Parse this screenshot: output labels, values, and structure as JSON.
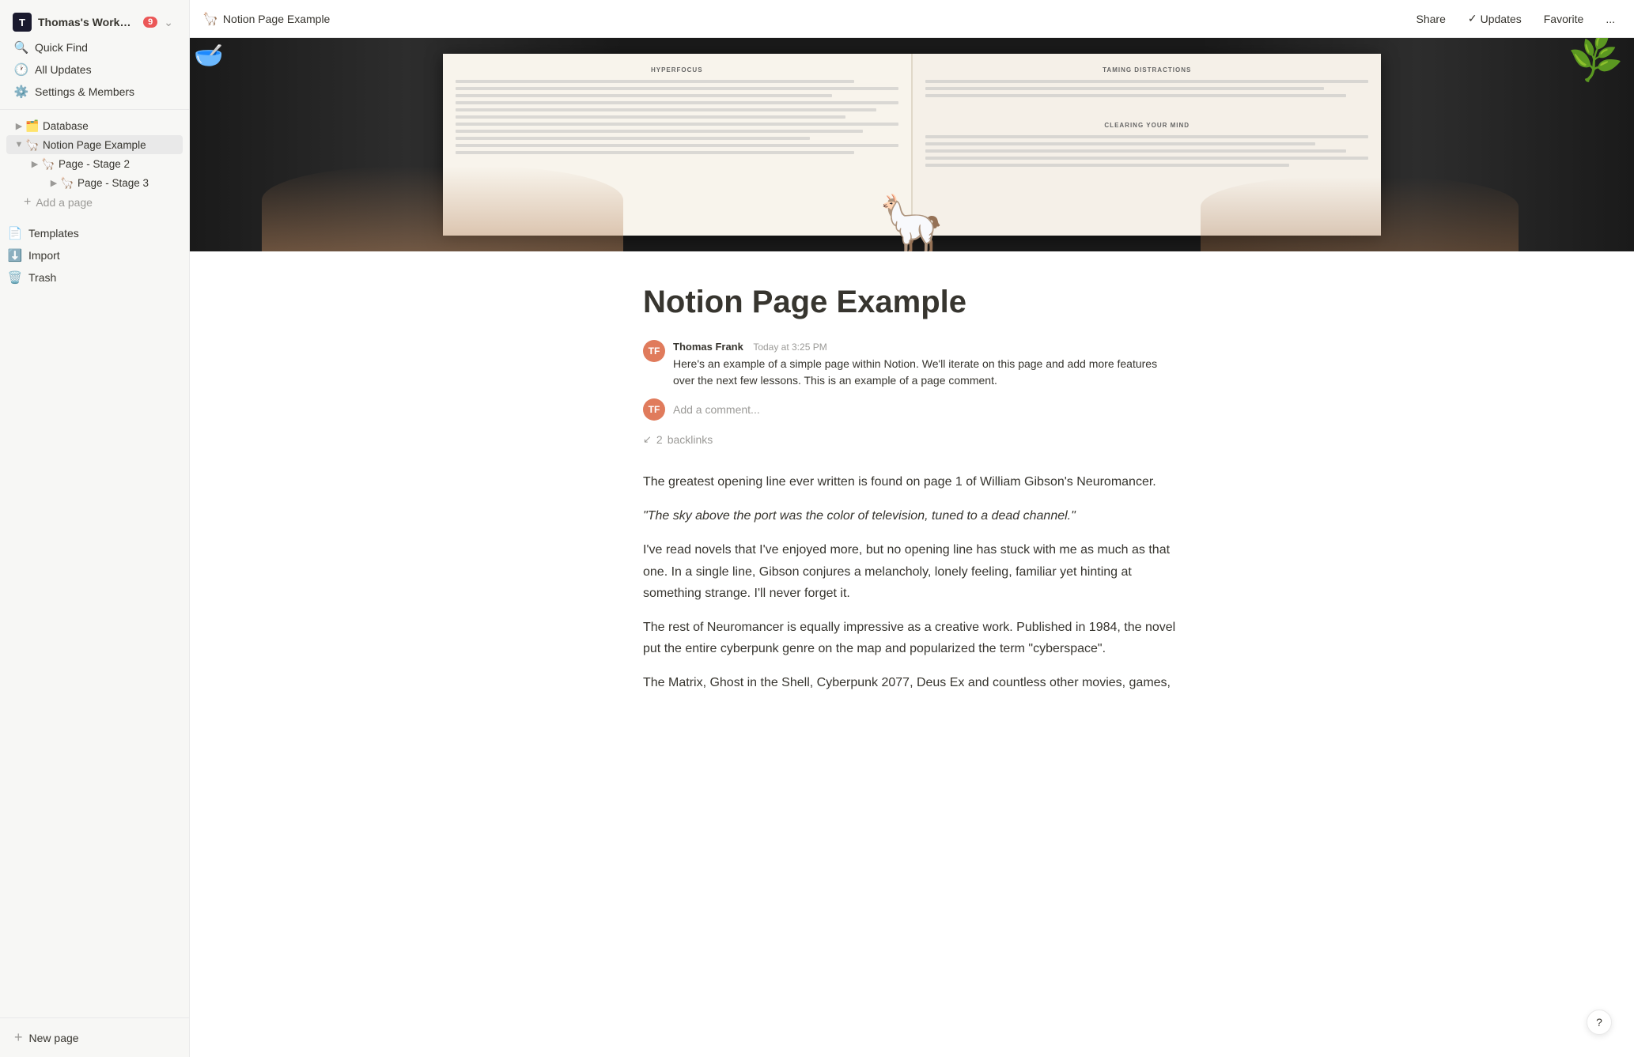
{
  "workspace": {
    "icon": "T",
    "name": "Thomas's Worksp...",
    "badge_count": "9"
  },
  "sidebar": {
    "quick_find": "Quick Find",
    "all_updates": "All Updates",
    "settings": "Settings & Members",
    "nav_items": [
      {
        "id": "database",
        "label": "Database",
        "icon": "🗂️",
        "level": 1,
        "arrow": "▶"
      },
      {
        "id": "notion-page-example",
        "label": "Notion Page Example",
        "icon": "🦙",
        "level": 1,
        "arrow": "▼",
        "active": true
      },
      {
        "id": "page-stage-2",
        "label": "Page - Stage 2",
        "icon": "🦙",
        "level": 2,
        "arrow": "▶"
      },
      {
        "id": "page-stage-3",
        "label": "Page - Stage 3",
        "icon": "🦙",
        "level": 3,
        "arrow": "▶"
      }
    ],
    "add_page": "Add a page",
    "templates": "Templates",
    "import": "Import",
    "trash": "Trash",
    "new_page": "New page"
  },
  "topbar": {
    "page_icon": "🦙",
    "page_title": "Notion Page Example",
    "share": "Share",
    "updates": "Updates",
    "favorite": "Favorite",
    "more": "..."
  },
  "page": {
    "title": "Notion Page Example",
    "author": "Thomas Frank",
    "timestamp": "Today at 3:25 PM",
    "comment": "Here's an example of a simple page within Notion. We'll iterate on this page and add more features over the next few lessons. This is an example of a page comment.",
    "add_comment_placeholder": "Add a comment...",
    "backlinks_count": "2",
    "backlinks_label": "backlinks",
    "paragraphs": [
      "The greatest opening line ever written is found on page 1 of William Gibson's Neuromancer.",
      "\"The sky above the port was the color of television, tuned to a dead channel.\"",
      "I've read novels that I've enjoyed more, but no opening line has stuck with me as much as that one. In a single line, Gibson conjures a melancholy, lonely feeling, familiar yet hinting at something strange. I'll never forget it.",
      "The rest of Neuromancer is equally impressive as a creative work. Published in 1984, the novel put the entire cyberpunk genre on the map and popularized the term \"cyberspace\".",
      "The Matrix, Ghost in the Shell, Cyberpunk 2077, Deus Ex and countless other movies, games,"
    ]
  },
  "help_btn": "?"
}
